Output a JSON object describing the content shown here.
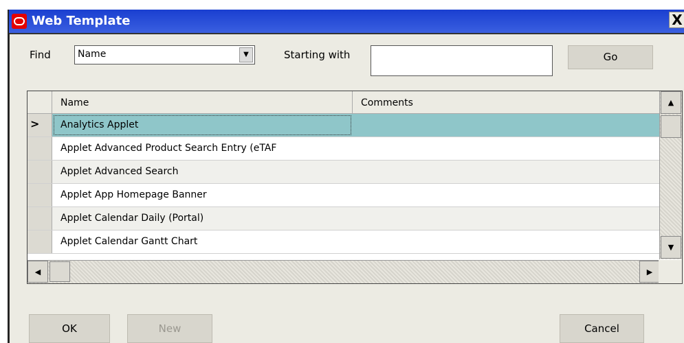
{
  "window": {
    "title": "Web Template",
    "close_label": "X"
  },
  "find": {
    "label": "Find",
    "field_value": "Name",
    "starting_label": "Starting with",
    "starting_value": "",
    "go_label": "Go"
  },
  "grid": {
    "columns": [
      "Name",
      "Comments"
    ],
    "rows": [
      {
        "name": "Analytics Applet",
        "comments": "",
        "selected": true
      },
      {
        "name": "Applet Advanced Product Search Entry (eTAF",
        "comments": ""
      },
      {
        "name": "Applet Advanced Search",
        "comments": ""
      },
      {
        "name": "Applet App Homepage Banner",
        "comments": ""
      },
      {
        "name": "Applet Calendar Daily (Portal)",
        "comments": ""
      },
      {
        "name": "Applet Calendar Gantt Chart",
        "comments": ""
      }
    ],
    "current_row_marker": ">"
  },
  "buttons": {
    "ok": "OK",
    "new": "New",
    "cancel": "Cancel"
  },
  "colors": {
    "title_bar": "#1a3fd0",
    "selected_row": "#8fc6c9",
    "alt_row": "#f0f0ec",
    "row": "#ffffff"
  }
}
